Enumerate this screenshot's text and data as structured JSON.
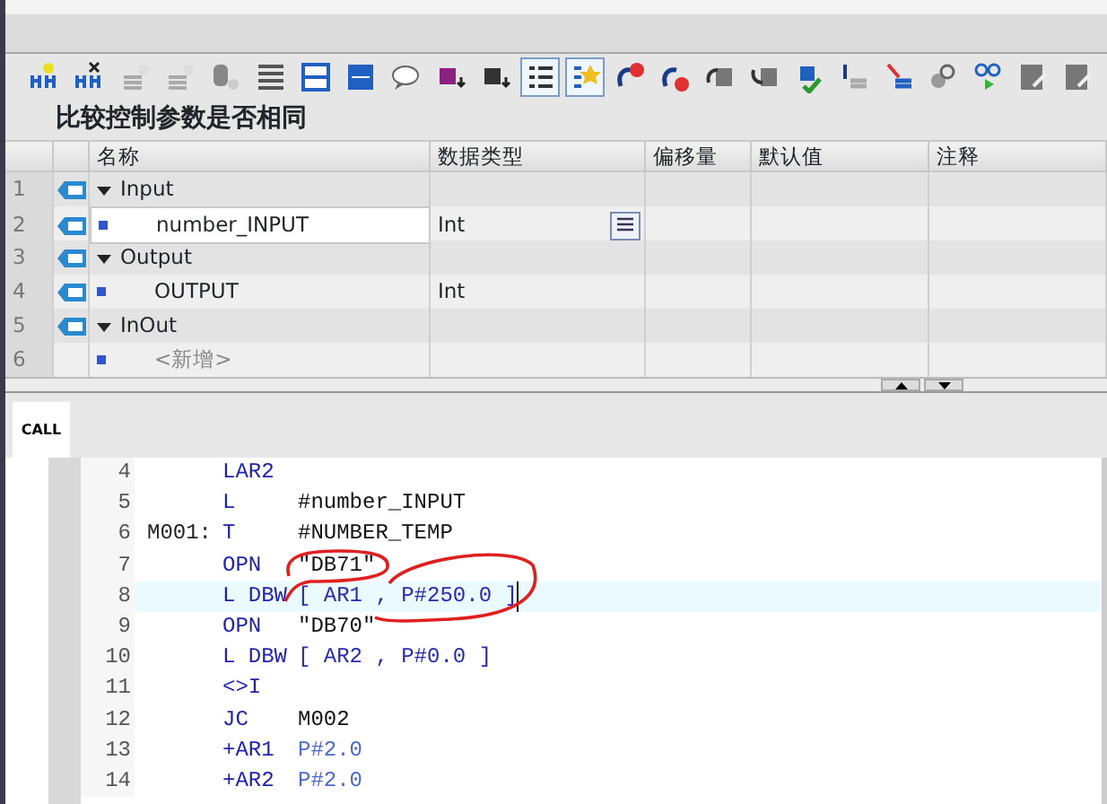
{
  "toolbar": [
    {
      "selected": false
    },
    {
      "selected": false
    },
    {
      "selected": false
    },
    {
      "selected": false
    },
    {
      "selected": false
    },
    {
      "selected": false
    },
    {
      "selected": false
    },
    {
      "selected": false
    },
    {
      "selected": false
    },
    {
      "selected": false
    },
    {
      "selected": false
    },
    {
      "selected": true
    },
    {
      "selected": true
    },
    {
      "selected": false
    },
    {
      "selected": false
    },
    {
      "selected": false
    },
    {
      "selected": false
    },
    {
      "selected": false
    },
    {
      "selected": false
    },
    {
      "selected": false
    },
    {
      "selected": false
    },
    {
      "selected": false
    },
    {
      "selected": false
    },
    {
      "selected": false
    }
  ],
  "block_title": "比较控制参数是否相同",
  "table": {
    "columns": [
      "名称",
      "数据类型",
      "偏移量",
      "默认值",
      "注释"
    ],
    "rows": [
      {
        "number": "1",
        "kind": "section",
        "name": "Input",
        "expanded": true,
        "selected": false
      },
      {
        "number": "2",
        "kind": "variable",
        "name": "number_INPUT",
        "data_type": "Int",
        "selected": true
      },
      {
        "number": "3",
        "kind": "section",
        "name": "Output",
        "expanded": true,
        "selected": false
      },
      {
        "number": "4",
        "kind": "variable",
        "name": "OUTPUT",
        "data_type": "Int",
        "selected": false
      },
      {
        "number": "5",
        "kind": "section",
        "name": "InOut",
        "expanded": true,
        "selected": false
      },
      {
        "number": "6",
        "kind": "placeholder",
        "name": "<新增>",
        "selected": false
      }
    ]
  },
  "tabs": [
    {
      "label": "CALL",
      "selected": true
    }
  ],
  "code": [
    {
      "number": "4",
      "instruction": "LAR2",
      "kind": "plain",
      "current": false
    },
    {
      "number": "5",
      "instruction": "L",
      "operand": "#number_INPUT",
      "kind": "symbol",
      "current": false
    },
    {
      "number": "6",
      "label": "M001:",
      "instruction": "T",
      "operand": "#NUMBER_TEMP",
      "kind": "symbol",
      "current": false
    },
    {
      "number": "7",
      "instruction": "OPN",
      "operand": "\"DB71\"",
      "kind": "symbol",
      "current": false
    },
    {
      "number": "8",
      "instruction": "L DBW",
      "operand": "[ AR1 , P#250.0 ]",
      "kind": "address",
      "current": true
    },
    {
      "number": "9",
      "instruction": "OPN",
      "operand": "\"DB70\"",
      "kind": "symbol",
      "current": false
    },
    {
      "number": "10",
      "instruction": "L DBW",
      "operand": "[ AR2 , P#0.0 ]",
      "kind": "address",
      "current": false
    },
    {
      "number": "11",
      "instruction": "<>I",
      "kind": "plain",
      "current": false
    },
    {
      "number": "12",
      "instruction": "JC",
      "operand": "M002",
      "kind": "symbol",
      "current": false
    },
    {
      "number": "13",
      "instruction": "+AR1",
      "operand": "P#2.0",
      "kind": "pointer",
      "current": false
    },
    {
      "number": "14",
      "instruction": "+AR2",
      "operand": "P#2.0",
      "kind": "pointer",
      "current": false
    }
  ]
}
